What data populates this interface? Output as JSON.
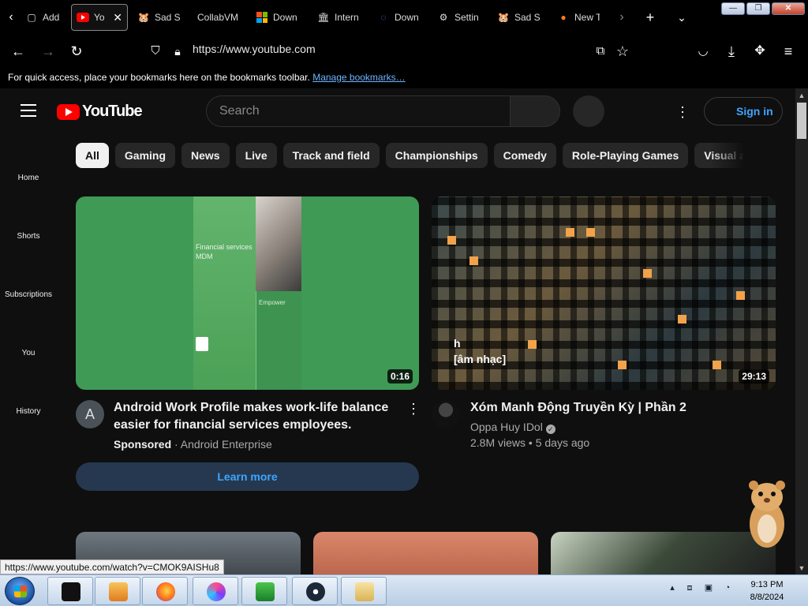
{
  "browser": {
    "tabs": [
      {
        "label": "Add-o",
        "icon": "puzzle-icon"
      },
      {
        "label": "You",
        "icon": "youtube-icon",
        "active": true
      },
      {
        "label": "Sad S",
        "icon": "hamster-icon"
      },
      {
        "label": "CollabVM",
        "icon": "none"
      },
      {
        "label": "Down",
        "icon": "microsoft-icon"
      },
      {
        "label": "Intern",
        "icon": "archive-icon"
      },
      {
        "label": "Down",
        "icon": "edge-icon"
      },
      {
        "label": "Settin",
        "icon": "gear-icon"
      },
      {
        "label": "Sad S",
        "icon": "hamster-icon"
      },
      {
        "label": "New T",
        "icon": "firefox-icon"
      }
    ],
    "tab_close": "✕",
    "url": "https://www.youtube.com",
    "bookmarks_text": "For quick access, place your bookmarks here on the bookmarks toolbar.",
    "bookmarks_link": "Manage bookmarks…",
    "status_url": "https://www.youtube.com/watch?v=CMOK9AISHu8"
  },
  "youtube": {
    "logo_text": "YouTube",
    "search_placeholder": "Search",
    "sign_in": "Sign in",
    "chips": [
      "All",
      "Gaming",
      "News",
      "Live",
      "Track and field",
      "Championships",
      "Comedy",
      "Role-Playing Games",
      "Visual a"
    ],
    "sidebar": [
      "Home",
      "Shorts",
      "Subscriptions",
      "You",
      "History"
    ],
    "videos": [
      {
        "title_line1": "Android Work Profile makes work-life balance",
        "title_line2": "easier for financial services employees.",
        "sponsored": "Sponsored",
        "channel": "Android Enterprise",
        "duration": "0:16",
        "avatar_letter": "A",
        "cta": "Learn more",
        "thumb_text1": "Financial services",
        "thumb_text2": "MDM",
        "thumb_text3": "Empower"
      },
      {
        "title": "Xóm Manh Động Truyền Kỳ | Phần 2",
        "channel": "Oppa Huy IDol",
        "views": "2.8M views",
        "age": "5 days ago",
        "duration": "29:13",
        "caption1": "h",
        "caption2": "[âm nhạc]"
      }
    ]
  },
  "taskbar": {
    "time": "9:13 PM",
    "date": "8/8/2024"
  },
  "colors": {
    "page_bg": "#0f0f0f",
    "brand_red": "#ff0000",
    "link_blue": "#3ea6ff"
  }
}
